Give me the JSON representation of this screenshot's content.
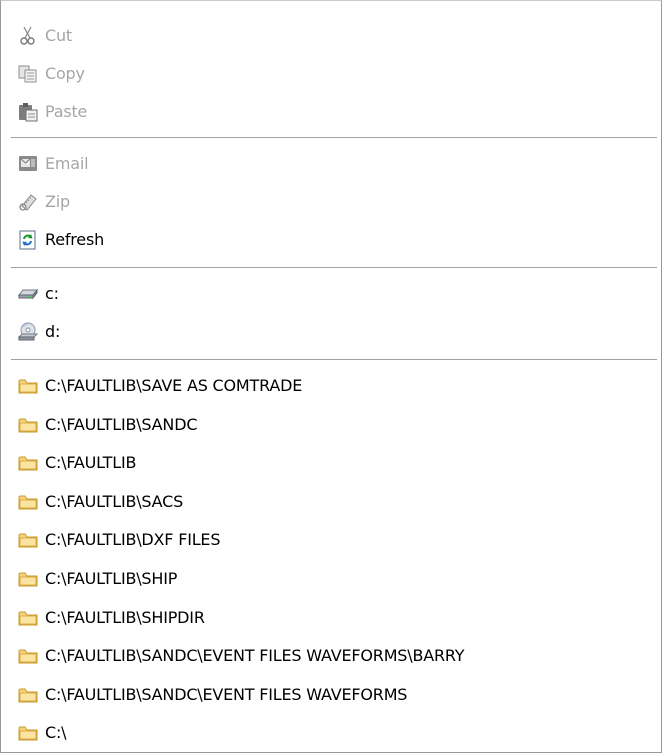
{
  "menu": {
    "edit": [
      {
        "label": "Cut",
        "icon": "scissors-icon",
        "enabled": false
      },
      {
        "label": "Copy",
        "icon": "copy-icon",
        "enabled": false
      },
      {
        "label": "Paste",
        "icon": "paste-icon",
        "enabled": false
      }
    ],
    "actions": [
      {
        "label": "Email",
        "icon": "email-icon",
        "enabled": false
      },
      {
        "label": "Zip",
        "icon": "zip-icon",
        "enabled": false
      },
      {
        "label": "Refresh",
        "icon": "refresh-icon",
        "enabled": true
      }
    ],
    "drives": [
      {
        "label": "c:",
        "icon": "hard-drive-icon",
        "enabled": true
      },
      {
        "label": "d:",
        "icon": "cd-drive-icon",
        "enabled": true
      }
    ],
    "folders": [
      {
        "label": "C:\\FAULTLIB\\SAVE AS COMTRADE",
        "icon": "folder-icon"
      },
      {
        "label": "C:\\FAULTLIB\\SANDC",
        "icon": "folder-icon"
      },
      {
        "label": "C:\\FAULTLIB",
        "icon": "folder-icon"
      },
      {
        "label": "C:\\FAULTLIB\\SACS",
        "icon": "folder-icon"
      },
      {
        "label": "C:\\FAULTLIB\\DXF FILES",
        "icon": "folder-icon"
      },
      {
        "label": "C:\\FAULTLIB\\SHIP",
        "icon": "folder-icon"
      },
      {
        "label": "C:\\FAULTLIB\\SHIPDIR",
        "icon": "folder-icon"
      },
      {
        "label": "C:\\FAULTLIB\\SANDC\\EVENT FILES  WAVEFORMS\\BARRY",
        "icon": "folder-icon"
      },
      {
        "label": "C:\\FAULTLIB\\SANDC\\EVENT FILES  WAVEFORMS",
        "icon": "folder-icon"
      },
      {
        "label": "C:\\",
        "icon": "folder-icon"
      }
    ]
  },
  "colors": {
    "disabled_text": "#a6a6a6",
    "enabled_text": "#000000",
    "separator": "#a0a0a0",
    "folder_fill": "#f5d27a",
    "folder_edge": "#c89a2a"
  }
}
